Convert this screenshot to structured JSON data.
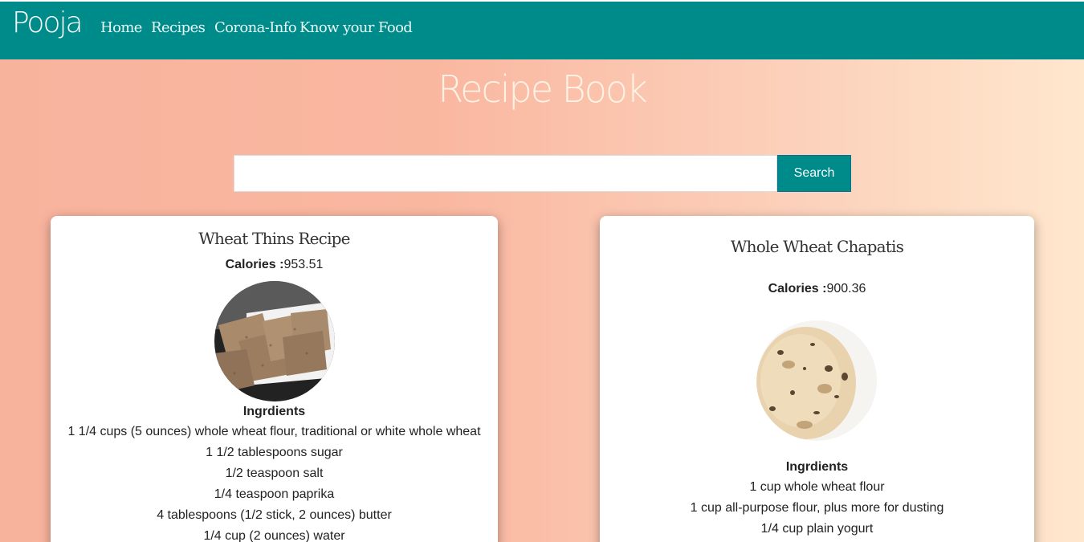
{
  "navbar": {
    "brand": "Pooja",
    "links": [
      "Home",
      "Recipes",
      "Corona-Info",
      "Know your Food"
    ]
  },
  "page_title": "Recipe Book",
  "search": {
    "value": "",
    "placeholder": "",
    "button_label": "Search"
  },
  "colors": {
    "navbar": "#008b8b",
    "button": "#008b8b",
    "background_start": "#f8b39d",
    "background_end": "#ffe7cd"
  },
  "recipes": [
    {
      "title": "Wheat Thins Recipe",
      "calories_label": "Calories :",
      "calories_value": "953.51",
      "image": "wheat-crackers-photo",
      "ingredients_heading": "Ingrdients",
      "ingredients": [
        "1 1/4 cups (5 ounces) whole wheat flour, traditional or white whole wheat",
        "1 1/2 tablespoons sugar",
        "1/2 teaspoon salt",
        "1/4 teaspoon paprika",
        "4 tablespoons (1/2 stick, 2 ounces) butter",
        "1/4 cup (2 ounces) water"
      ]
    },
    {
      "title": "Whole Wheat Chapatis",
      "calories_label": "Calories :",
      "calories_value": "900.36",
      "image": "chapati-photo",
      "ingredients_heading": "Ingrdients",
      "ingredients": [
        "1 cup whole wheat flour",
        "1 cup all-purpose flour, plus more for dusting",
        "1/4 cup plain yogurt"
      ]
    }
  ]
}
